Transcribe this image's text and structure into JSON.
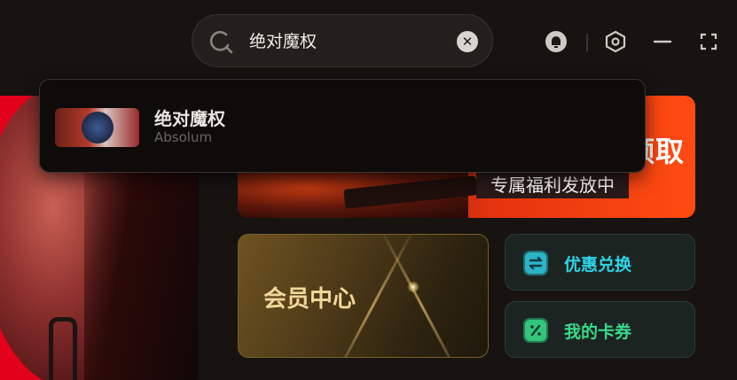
{
  "search": {
    "query": "绝对魔权"
  },
  "dropdown": {
    "results": [
      {
        "title": "绝对魔权",
        "subtitle": "Absolum"
      }
    ]
  },
  "banner": {
    "headline": "领取",
    "subtitle": "专属福利发放中"
  },
  "member_center": {
    "label": "会员中心"
  },
  "cards": [
    {
      "label": "优惠兑换",
      "icon": "exchange-icon",
      "color": "#2fd3e6"
    },
    {
      "label": "我的卡券",
      "icon": "coupon-icon",
      "color": "#39d98a"
    }
  ],
  "window_controls": {
    "icons": [
      "notification-bell-icon",
      "settings-hex-icon",
      "minimize-icon",
      "fullscreen-icon"
    ]
  },
  "colors": {
    "background": "#161311",
    "accent_orange": "#ff4b12",
    "gold": "#f3d79a"
  }
}
